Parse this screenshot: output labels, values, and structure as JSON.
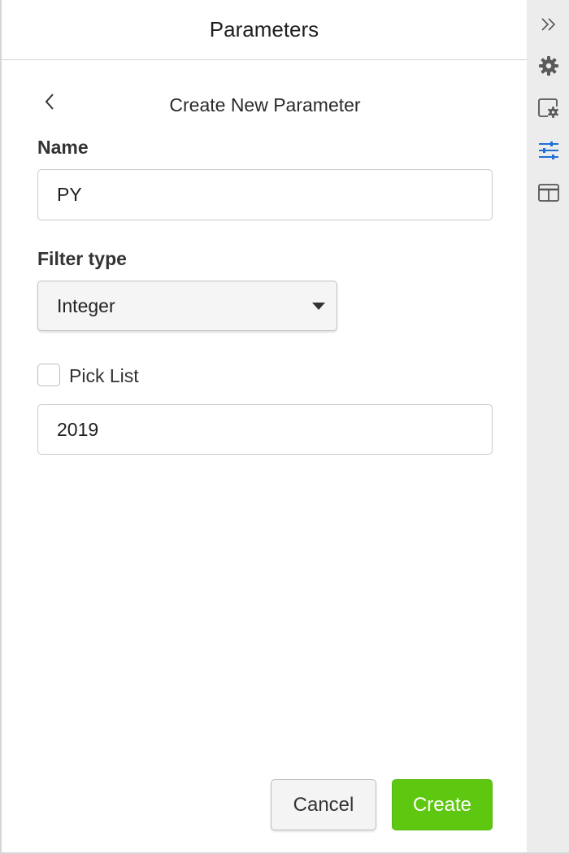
{
  "panel": {
    "title": "Parameters",
    "subtitle": "Create New Parameter"
  },
  "form": {
    "name_label": "Name",
    "name_value": "PY",
    "filter_type_label": "Filter type",
    "filter_type_value": "Integer",
    "pick_list_label": "Pick List",
    "pick_list_checked": false,
    "default_value": "2019"
  },
  "footer": {
    "cancel_label": "Cancel",
    "create_label": "Create"
  },
  "rail": {
    "icons": [
      "collapse-chevrons-icon",
      "gear-icon",
      "panel-settings-icon",
      "sliders-icon",
      "layout-icon"
    ],
    "active_icon": "sliders-icon"
  },
  "colors": {
    "primary_green": "#5ec811",
    "active_blue": "#1f6fd6",
    "rail_bg": "#ececec"
  }
}
